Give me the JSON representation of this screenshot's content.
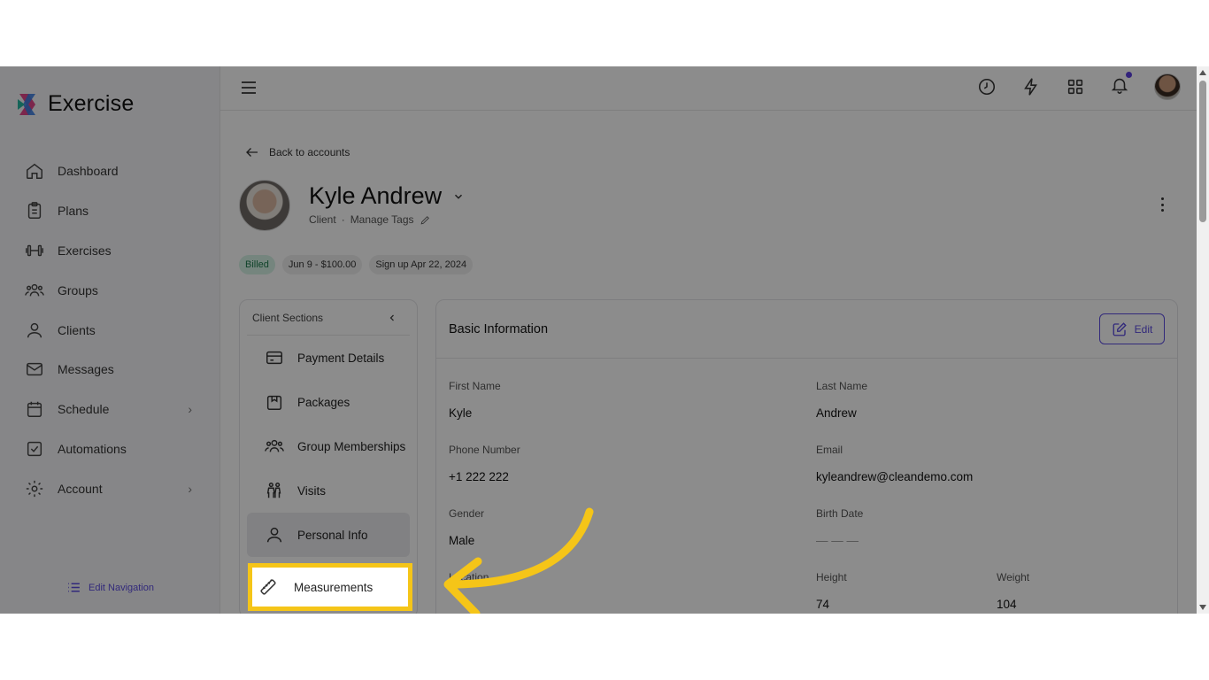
{
  "app": {
    "name": "Exercise"
  },
  "sidebar": {
    "items": [
      {
        "label": "Dashboard",
        "icon": "home-icon"
      },
      {
        "label": "Plans",
        "icon": "clipboard-icon"
      },
      {
        "label": "Exercises",
        "icon": "dumbbell-icon"
      },
      {
        "label": "Groups",
        "icon": "users-icon"
      },
      {
        "label": "Clients",
        "icon": "user-icon"
      },
      {
        "label": "Messages",
        "icon": "mail-icon"
      },
      {
        "label": "Schedule",
        "icon": "calendar-icon",
        "chevron": "›"
      },
      {
        "label": "Automations",
        "icon": "checkbox-icon"
      },
      {
        "label": "Account",
        "icon": "gear-icon",
        "chevron": "›"
      }
    ],
    "edit_navigation": "Edit Navigation"
  },
  "back_link": "Back to accounts",
  "client": {
    "name": "Kyle Andrew",
    "role": "Client",
    "separator": "·",
    "manage_tags": "Manage Tags"
  },
  "badges": [
    "Billed",
    "Jun 9 - $100.00",
    "Sign up Apr 22, 2024"
  ],
  "sections": {
    "title": "Client Sections",
    "collapse": "‹",
    "items": [
      {
        "label": "Payment Details",
        "icon": "credit-card-icon"
      },
      {
        "label": "Packages",
        "icon": "package-icon"
      },
      {
        "label": "Group Memberships",
        "icon": "group-icon"
      },
      {
        "label": "Visits",
        "icon": "visits-icon"
      },
      {
        "label": "Personal Info",
        "icon": "person-icon"
      },
      {
        "label": "Measurements",
        "icon": "ruler-icon"
      }
    ]
  },
  "basic_info": {
    "title": "Basic Information",
    "edit_label": "Edit",
    "fields": {
      "first_name": {
        "label": "First Name",
        "value": "Kyle"
      },
      "last_name": {
        "label": "Last Name",
        "value": "Andrew"
      },
      "phone": {
        "label": "Phone Number",
        "value": "+1 222 222"
      },
      "email": {
        "label": "Email",
        "value": "kyleandrew@cleandemo.com"
      },
      "gender": {
        "label": "Gender",
        "value": "Male"
      },
      "birth_date": {
        "label": "Birth Date",
        "value": "— — —"
      },
      "location": {
        "label": "Location",
        "value": ""
      },
      "height": {
        "label": "Height",
        "value": "74"
      },
      "weight": {
        "label": "Weight",
        "value": "104"
      }
    }
  },
  "colors": {
    "accent": "#5b4be0",
    "highlight": "#f5c518",
    "billed_bg": "#d6f3e6"
  }
}
